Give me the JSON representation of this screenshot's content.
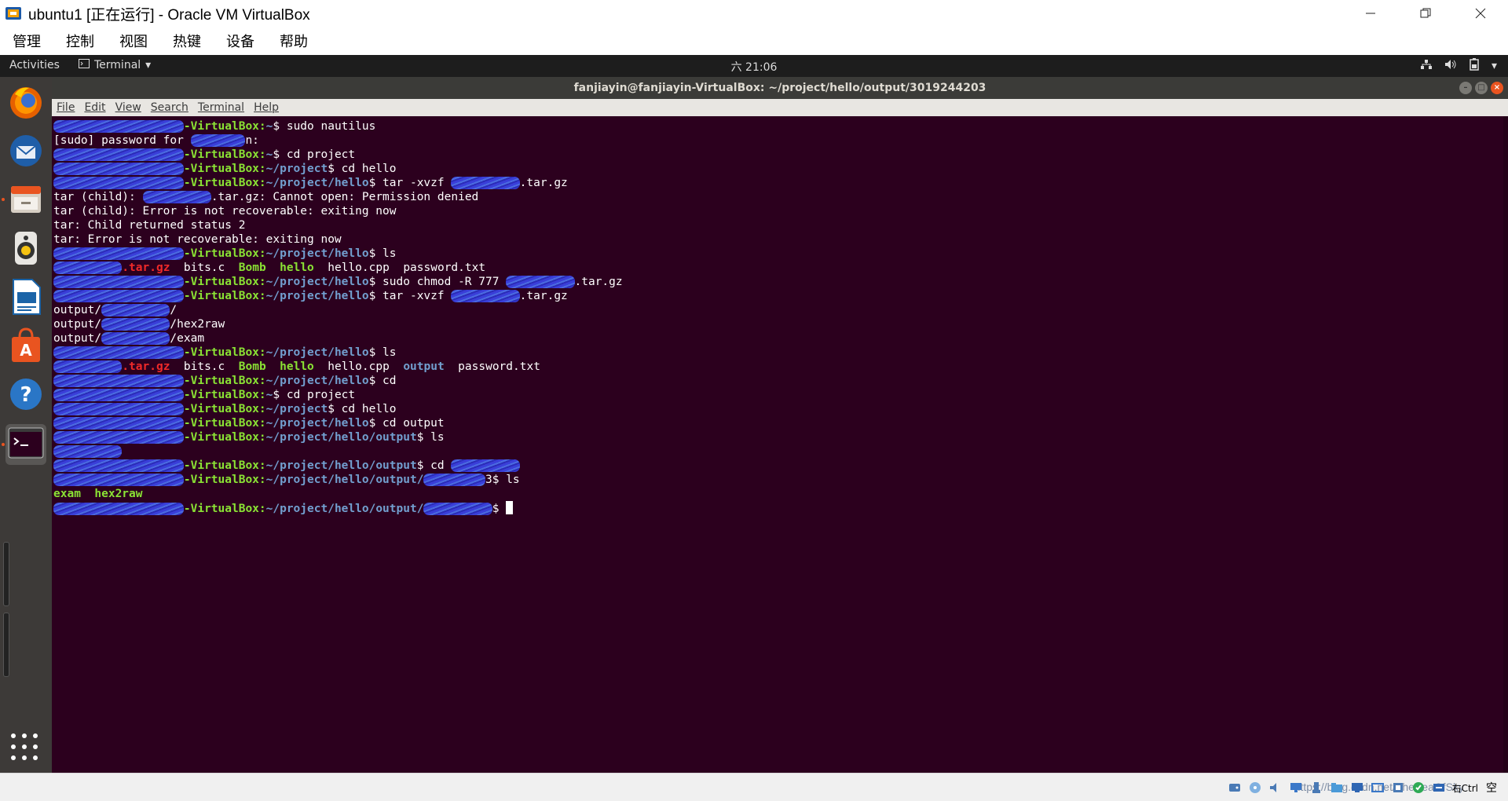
{
  "host_window": {
    "title": "ubuntu1 [正在运行] - Oracle VM VirtualBox",
    "controls": {
      "minimize": "—",
      "restore": "❐",
      "close": "✕"
    }
  },
  "host_menu": [
    "管理",
    "控制",
    "视图",
    "热键",
    "设备",
    "帮助"
  ],
  "gnome_topbar": {
    "activities": "Activities",
    "app_menu": "Terminal",
    "clock": "六 21:06",
    "tray_icons": [
      "network-icon",
      "volume-icon",
      "battery-icon",
      "system-menu-arrow-icon"
    ]
  },
  "dock": {
    "items": [
      {
        "name": "firefox",
        "icon": "firefox-icon",
        "running": false
      },
      {
        "name": "thunderbird",
        "icon": "thunderbird-mail-icon",
        "running": false
      },
      {
        "name": "files",
        "icon": "files-cabinet-icon",
        "running": true
      },
      {
        "name": "rhythmbox",
        "icon": "rhythmbox-speaker-icon",
        "running": false
      },
      {
        "name": "libreoffice-writer",
        "icon": "writer-document-icon",
        "running": false
      },
      {
        "name": "ubuntu-software",
        "icon": "software-bag-icon",
        "running": false
      },
      {
        "name": "help",
        "icon": "help-question-icon",
        "running": false
      },
      {
        "name": "terminal",
        "icon": "terminal-prompt-icon",
        "running": true,
        "active": true
      }
    ],
    "show_apps_icon": "apps-grid-icon"
  },
  "terminal": {
    "title": "fanjiayin@fanjiayin-VirtualBox: ~/project/hello/output/3019244203",
    "window_controls": {
      "minimize": "–",
      "maximize": "□",
      "close": "×"
    },
    "menu": [
      "File",
      "Edit",
      "View",
      "Search",
      "Terminal",
      "Help"
    ],
    "lines": [
      [
        {
          "t": "fanjiayin@fanjiayin",
          "c": "user redact"
        },
        {
          "t": "-VirtualBox:",
          "c": "user"
        },
        {
          "t": "~",
          "c": "path"
        },
        {
          "t": "$ sudo nautilus",
          "c": "plain"
        }
      ],
      [
        {
          "t": "[sudo] password for ",
          "c": "plain"
        },
        {
          "t": "fanjiayi",
          "c": "plain redact"
        },
        {
          "t": "n:",
          "c": "plain"
        }
      ],
      [
        {
          "t": "fanjiayin@fanjiayin",
          "c": "user redact"
        },
        {
          "t": "-VirtualBox:",
          "c": "user"
        },
        {
          "t": "~",
          "c": "path"
        },
        {
          "t": "$ cd project",
          "c": "plain"
        }
      ],
      [
        {
          "t": "fanjiayin@fanjiayin",
          "c": "user redact"
        },
        {
          "t": "-VirtualBox:",
          "c": "user"
        },
        {
          "t": "~/project",
          "c": "path"
        },
        {
          "t": "$ cd hello",
          "c": "plain"
        }
      ],
      [
        {
          "t": "fanjiayin@fanjiayin",
          "c": "user redact"
        },
        {
          "t": "-VirtualBox:",
          "c": "user"
        },
        {
          "t": "~/project/hello",
          "c": "path"
        },
        {
          "t": "$ tar -xvzf ",
          "c": "plain"
        },
        {
          "t": "3019244203",
          "c": "plain redact"
        },
        {
          "t": ".tar.gz",
          "c": "plain"
        }
      ],
      [
        {
          "t": "tar (child): ",
          "c": "plain"
        },
        {
          "t": "3019244203",
          "c": "plain redact"
        },
        {
          "t": ".tar.gz: Cannot open: Permission denied",
          "c": "plain"
        }
      ],
      [
        {
          "t": "tar (child): Error is not recoverable: exiting now",
          "c": "plain"
        }
      ],
      [
        {
          "t": "tar: Child returned status 2",
          "c": "plain"
        }
      ],
      [
        {
          "t": "tar: Error is not recoverable: exiting now",
          "c": "plain"
        }
      ],
      [
        {
          "t": "fanjiayin@fanjiayin",
          "c": "user redact"
        },
        {
          "t": "-VirtualBox:",
          "c": "user"
        },
        {
          "t": "~/project/hello",
          "c": "path"
        },
        {
          "t": "$ ls",
          "c": "plain"
        }
      ],
      [
        {
          "t": "3019244203",
          "c": "archive redact"
        },
        {
          "t": ".tar.gz",
          "c": "archive"
        },
        {
          "t": "  ",
          "c": "plain"
        },
        {
          "t": "bits.c",
          "c": "file"
        },
        {
          "t": "  ",
          "c": "plain"
        },
        {
          "t": "Bomb",
          "c": "exec"
        },
        {
          "t": "  ",
          "c": "plain"
        },
        {
          "t": "hello",
          "c": "exec"
        },
        {
          "t": "  ",
          "c": "plain"
        },
        {
          "t": "hello.cpp",
          "c": "file"
        },
        {
          "t": "  ",
          "c": "plain"
        },
        {
          "t": "password.txt",
          "c": "file"
        }
      ],
      [
        {
          "t": "fanjiayin@fanjiayin",
          "c": "user redact"
        },
        {
          "t": "-VirtualBox:",
          "c": "user"
        },
        {
          "t": "~/project/hello",
          "c": "path"
        },
        {
          "t": "$ sudo chmod -R 777 ",
          "c": "plain"
        },
        {
          "t": "3019244203",
          "c": "plain redact"
        },
        {
          "t": ".tar.gz",
          "c": "plain"
        }
      ],
      [
        {
          "t": "fanjiayin@fanjiayin",
          "c": "user redact"
        },
        {
          "t": "-VirtualBox:",
          "c": "user"
        },
        {
          "t": "~/project/hello",
          "c": "path"
        },
        {
          "t": "$ tar -xvzf ",
          "c": "plain"
        },
        {
          "t": "3019244203",
          "c": "plain redact"
        },
        {
          "t": ".tar.gz",
          "c": "plain"
        }
      ],
      [
        {
          "t": "output/",
          "c": "plain"
        },
        {
          "t": "3019244203",
          "c": "plain redact"
        },
        {
          "t": "/",
          "c": "plain"
        }
      ],
      [
        {
          "t": "output/",
          "c": "plain"
        },
        {
          "t": "3019244203",
          "c": "plain redact"
        },
        {
          "t": "/hex2raw",
          "c": "plain"
        }
      ],
      [
        {
          "t": "output/",
          "c": "plain"
        },
        {
          "t": "3019244203",
          "c": "plain redact"
        },
        {
          "t": "/exam",
          "c": "plain"
        }
      ],
      [
        {
          "t": "fanjiayin@fanjiayin",
          "c": "user redact"
        },
        {
          "t": "-VirtualBox:",
          "c": "user"
        },
        {
          "t": "~/project/hello",
          "c": "path"
        },
        {
          "t": "$ ls",
          "c": "plain"
        }
      ],
      [
        {
          "t": "3019244203",
          "c": "archive redact"
        },
        {
          "t": ".tar.gz",
          "c": "archive"
        },
        {
          "t": "  ",
          "c": "plain"
        },
        {
          "t": "bits.c",
          "c": "file"
        },
        {
          "t": "  ",
          "c": "plain"
        },
        {
          "t": "Bomb",
          "c": "exec"
        },
        {
          "t": "  ",
          "c": "plain"
        },
        {
          "t": "hello",
          "c": "exec"
        },
        {
          "t": "  ",
          "c": "plain"
        },
        {
          "t": "hello.cpp",
          "c": "file"
        },
        {
          "t": "  ",
          "c": "plain"
        },
        {
          "t": "output",
          "c": "dir"
        },
        {
          "t": "  ",
          "c": "plain"
        },
        {
          "t": "password.txt",
          "c": "file"
        }
      ],
      [
        {
          "t": "fanjiayin@fanjiayin",
          "c": "user redact"
        },
        {
          "t": "-VirtualBox:",
          "c": "user"
        },
        {
          "t": "~/project/hello",
          "c": "path"
        },
        {
          "t": "$ cd",
          "c": "plain"
        }
      ],
      [
        {
          "t": "fanjiayin@fanjiayin",
          "c": "user redact"
        },
        {
          "t": "-VirtualBox:",
          "c": "user"
        },
        {
          "t": "~",
          "c": "path"
        },
        {
          "t": "$ cd project",
          "c": "plain"
        }
      ],
      [
        {
          "t": "fanjiayin@fanjiayin",
          "c": "user redact"
        },
        {
          "t": "-VirtualBox:",
          "c": "user"
        },
        {
          "t": "~/project",
          "c": "path"
        },
        {
          "t": "$ cd hello",
          "c": "plain"
        }
      ],
      [
        {
          "t": "fanjiayin@fanjiayin",
          "c": "user redact"
        },
        {
          "t": "-VirtualBox:",
          "c": "user"
        },
        {
          "t": "~/project/hello",
          "c": "path"
        },
        {
          "t": "$ cd output",
          "c": "plain"
        }
      ],
      [
        {
          "t": "fanjiayin@fanjiayin",
          "c": "user redact"
        },
        {
          "t": "-VirtualBox:",
          "c": "user"
        },
        {
          "t": "~/project/hello/output",
          "c": "path"
        },
        {
          "t": "$ ls",
          "c": "plain"
        }
      ],
      [
        {
          "t": "3019244203",
          "c": "dir redact"
        }
      ],
      [
        {
          "t": "fanjiayin@fanjiayin",
          "c": "user redact"
        },
        {
          "t": "-VirtualBox:",
          "c": "user"
        },
        {
          "t": "~/project/hello/output",
          "c": "path"
        },
        {
          "t": "$ cd ",
          "c": "plain"
        },
        {
          "t": "3019244203",
          "c": "plain redact"
        }
      ],
      [
        {
          "t": "fanjiayin@fanjiayin",
          "c": "user redact"
        },
        {
          "t": "-VirtualBox:",
          "c": "user"
        },
        {
          "t": "~/project/hello/output/",
          "c": "path"
        },
        {
          "t": "301924420",
          "c": "path redact"
        },
        {
          "t": "3$ ls",
          "c": "plain"
        }
      ],
      [
        {
          "t": "exam",
          "c": "exec"
        },
        {
          "t": "  ",
          "c": "plain"
        },
        {
          "t": "hex2raw",
          "c": "exec"
        }
      ],
      [
        {
          "t": "fanjiayin@fanjiayin",
          "c": "user redact"
        },
        {
          "t": "-VirtualBox:",
          "c": "user"
        },
        {
          "t": "~/project/hello/output/",
          "c": "path"
        },
        {
          "t": "3019244203",
          "c": "path redact"
        },
        {
          "t": "$ ",
          "c": "plain"
        },
        {
          "t": "",
          "c": "cursor"
        }
      ]
    ]
  },
  "host_statusbar": {
    "icons": [
      "hard-disk-icon",
      "optical-disk-icon",
      "audio-icon",
      "network-icon",
      "usb-icon",
      "shared-folders-icon",
      "display-icon",
      "video-capture-icon",
      "cpu-icon",
      "mouse-integration-icon",
      "host-key-icon"
    ],
    "watermark": "https://blog.csdn.net/TheSeaOfSky",
    "host_key_label": "右Ctrl",
    "ime_label": "空"
  },
  "colors": {
    "terminal_bg": "#2c001e",
    "prompt_user": "#8ae234",
    "prompt_path": "#729fcf",
    "archive": "#ef2929",
    "ubuntu_orange": "#e95420"
  }
}
